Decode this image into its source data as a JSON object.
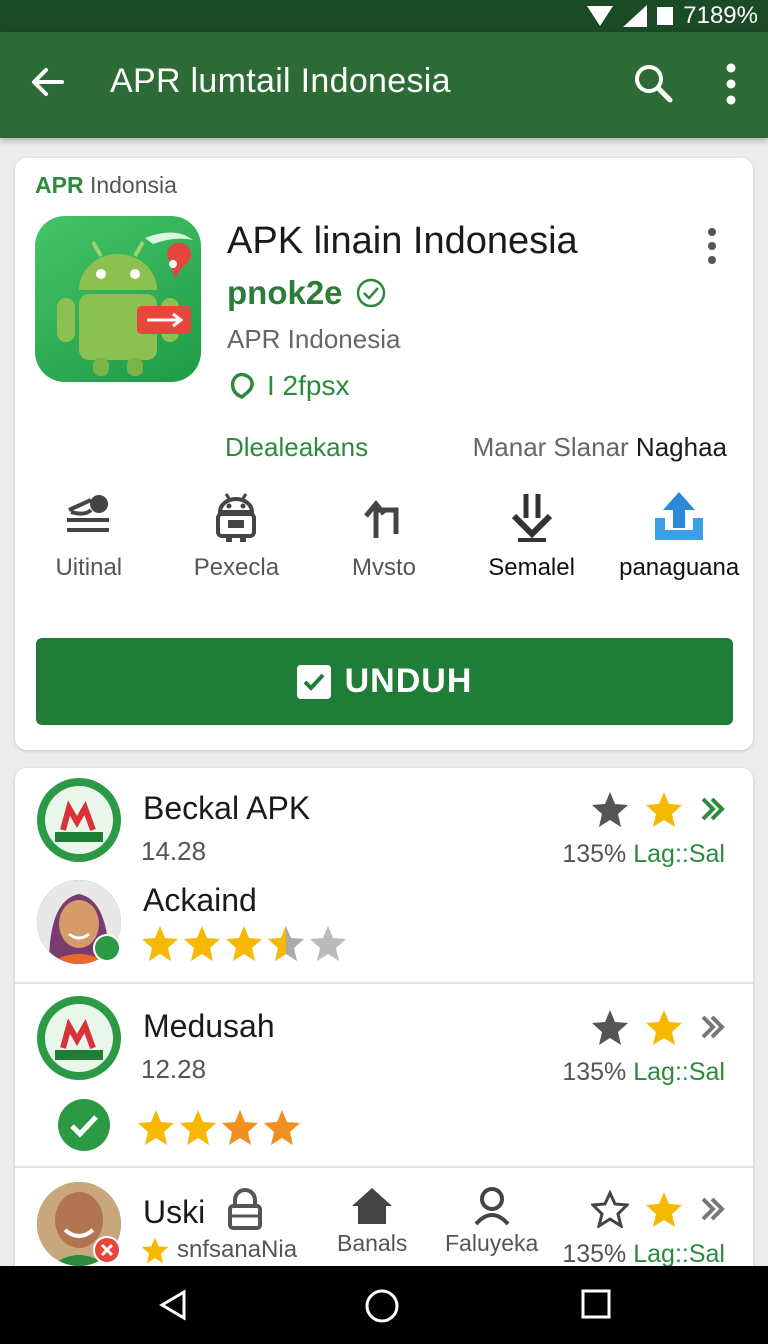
{
  "status_bar": {
    "battery": "7189%"
  },
  "toolbar": {
    "title": "APR lumtail Indonesia"
  },
  "app_card": {
    "brand_bold": "APR",
    "brand_rest": " Indonsia",
    "title": "APK linain Indonesia",
    "developer": "pnok2e",
    "publisher": "APR Indonesia",
    "size": "I 2fpsx",
    "link_left": "Dlealeakans",
    "link_right_light": "Manar Slanar",
    "link_right_dark": "Naghaa",
    "actions": [
      {
        "icon": "uninstall-icon",
        "label": "Uitinal"
      },
      {
        "icon": "android-robot-icon",
        "label": "Pexecla"
      },
      {
        "icon": "share-arrow-icon",
        "label": "Mvsto"
      },
      {
        "icon": "download-icon",
        "label": "Semalel"
      },
      {
        "icon": "upload-icon",
        "label": "panaguana"
      }
    ],
    "download_label": "UNDUH"
  },
  "list": {
    "items": [
      {
        "title": "Beckal APK",
        "number": "14.28",
        "percent": "135%",
        "meta": "Lag::Sal"
      },
      {
        "title": "Ackaind",
        "rating": 3.5
      },
      {
        "title": "Medusah",
        "number": "12.28",
        "percent": "135%",
        "meta": "Lag::Sal",
        "rating": 3.5
      },
      {
        "title": "Uski",
        "subtitle": "snfsanaNia",
        "percent": "135%",
        "meta": "Lag::Sal"
      }
    ],
    "bottom_tabs": [
      {
        "icon": "home-icon",
        "label": "Banals"
      },
      {
        "icon": "person-icon",
        "label": "Faluyeka"
      }
    ]
  },
  "colors": {
    "primary": "#2c6b35",
    "accent": "#2c8a3e",
    "button": "#1f7d37",
    "star": "#f6b800"
  }
}
